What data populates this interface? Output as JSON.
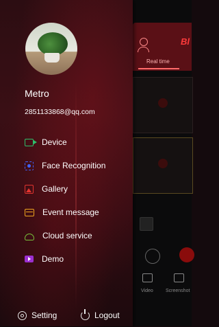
{
  "background_app": {
    "brand": "Bl",
    "tab_label": "Real time",
    "bottom_labels": [
      "Video",
      "Screenshot"
    ]
  },
  "drawer": {
    "username": "Metro",
    "email": "2851133868@qq.com",
    "menu": [
      {
        "label": "Device",
        "icon": "video-camera-icon",
        "color": "#2ec06b"
      },
      {
        "label": "Face Recognition",
        "icon": "face-scan-icon",
        "color": "#3f63ff"
      },
      {
        "label": "Gallery",
        "icon": "image-icon",
        "color": "#e2342f"
      },
      {
        "label": "Event message",
        "icon": "mail-icon",
        "color": "#f0a61e"
      },
      {
        "label": "Cloud service",
        "icon": "cloud-icon",
        "color": "#79c23b"
      },
      {
        "label": "Demo",
        "icon": "play-icon",
        "color": "#9b2fd0"
      }
    ],
    "footer": {
      "setting_label": "Setting",
      "logout_label": "Logout"
    }
  }
}
